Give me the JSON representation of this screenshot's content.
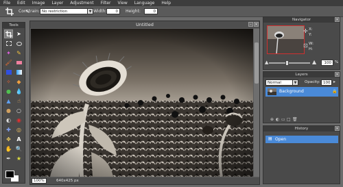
{
  "menu": [
    "File",
    "Edit",
    "Image",
    "Layer",
    "Adjustment",
    "Filter",
    "View",
    "Language",
    "Help"
  ],
  "options": {
    "constrain_label": "Constrain:",
    "constrain_value": "No restriction",
    "width_label": "Width:",
    "width_value": "0",
    "height_label": "Height:",
    "height_value": "0"
  },
  "tools": {
    "title": "Tools"
  },
  "canvas": {
    "title": "Untitled",
    "zoom": "100%",
    "size": "640x425 px"
  },
  "navigator": {
    "title": "Navigator",
    "x_label": "X:",
    "y_label": "Y:",
    "w_label": "W:",
    "h_label": "H:",
    "zoom_value": "100",
    "zoom_unit": "%"
  },
  "layers": {
    "title": "Layers",
    "blend_mode": "Normal",
    "opacity_label": "Opacity:",
    "opacity_value": "100",
    "items": [
      {
        "name": "Background"
      }
    ]
  },
  "history": {
    "title": "History",
    "items": [
      {
        "name": "Open"
      }
    ]
  },
  "colors": {
    "accent": "#4a8ad8",
    "fg": "#000000",
    "bg": "#ffffff"
  }
}
